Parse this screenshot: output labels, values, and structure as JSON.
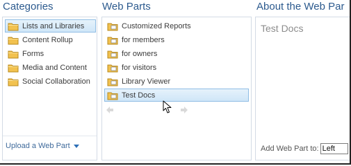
{
  "headings": {
    "categories": "Categories",
    "web_parts": "Web Parts",
    "about": "About the Web Par"
  },
  "categories": [
    {
      "label": "Lists and Libraries",
      "icon": "folder-icon",
      "selected": true
    },
    {
      "label": "Content Rollup",
      "icon": "folder-icon",
      "selected": false
    },
    {
      "label": "Forms",
      "icon": "folder-icon",
      "selected": false
    },
    {
      "label": "Media and Content",
      "icon": "folder-icon",
      "selected": false
    },
    {
      "label": "Social Collaboration",
      "icon": "folder-icon",
      "selected": false
    }
  ],
  "web_parts": [
    {
      "label": "Customized Reports",
      "icon": "web-part-icon",
      "selected": false
    },
    {
      "label": "for members",
      "icon": "web-part-icon",
      "selected": false
    },
    {
      "label": "for owners",
      "icon": "web-part-icon",
      "selected": false
    },
    {
      "label": "for visitors",
      "icon": "web-part-icon",
      "selected": false
    },
    {
      "label": "Library Viewer",
      "icon": "web-part-icon",
      "selected": false
    },
    {
      "label": "Test Docs",
      "icon": "web-part-icon",
      "selected": true
    }
  ],
  "upload": {
    "label": "Upload a Web Part"
  },
  "about": {
    "title": "Test Docs",
    "add_label": "Add Web Part to:",
    "add_value": "Left"
  },
  "colors": {
    "heading": "#2c5a8e",
    "selection_bg": "#cfe6f8",
    "selection_border": "#8fbde4",
    "folder": "#e8b43c"
  }
}
